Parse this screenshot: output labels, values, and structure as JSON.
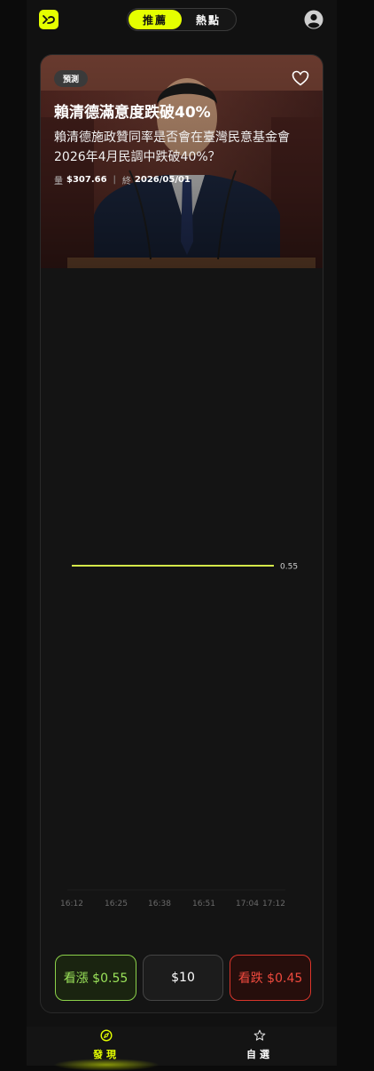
{
  "header": {
    "tabs": [
      {
        "label": "推薦",
        "active": true
      },
      {
        "label": "熱點",
        "active": false
      }
    ]
  },
  "card": {
    "badge": "預測",
    "title": "賴清德滿意度跌破40%",
    "subtitle": "賴清德施政贊同率是否會在臺灣民意基金會2026年4月民調中跌破40%？",
    "volume_label": "量",
    "volume_value": "$307.66",
    "end_label": "終",
    "end_value": "2026/05/01"
  },
  "chart_data": {
    "type": "line",
    "x": [
      "16:12",
      "16:25",
      "16:38",
      "16:51",
      "17:04",
      "17:12"
    ],
    "series": [
      {
        "values": [
          0.55,
          0.55,
          0.55,
          0.55,
          0.55,
          0.55
        ]
      }
    ],
    "last_value_label": "0.55",
    "line_color": "#d4e84a"
  },
  "actions": {
    "up_label": "看漲 $0.55",
    "amount_label": "$10",
    "down_label": "看跌 $0.45"
  },
  "nav": {
    "items": [
      {
        "label": "發現",
        "icon": "compass-icon",
        "active": true
      },
      {
        "label": "自選",
        "icon": "star-icon",
        "active": false
      }
    ]
  },
  "colors": {
    "accent": "#e5ff00",
    "up": "#9be35a",
    "down": "#ef4a3e"
  }
}
